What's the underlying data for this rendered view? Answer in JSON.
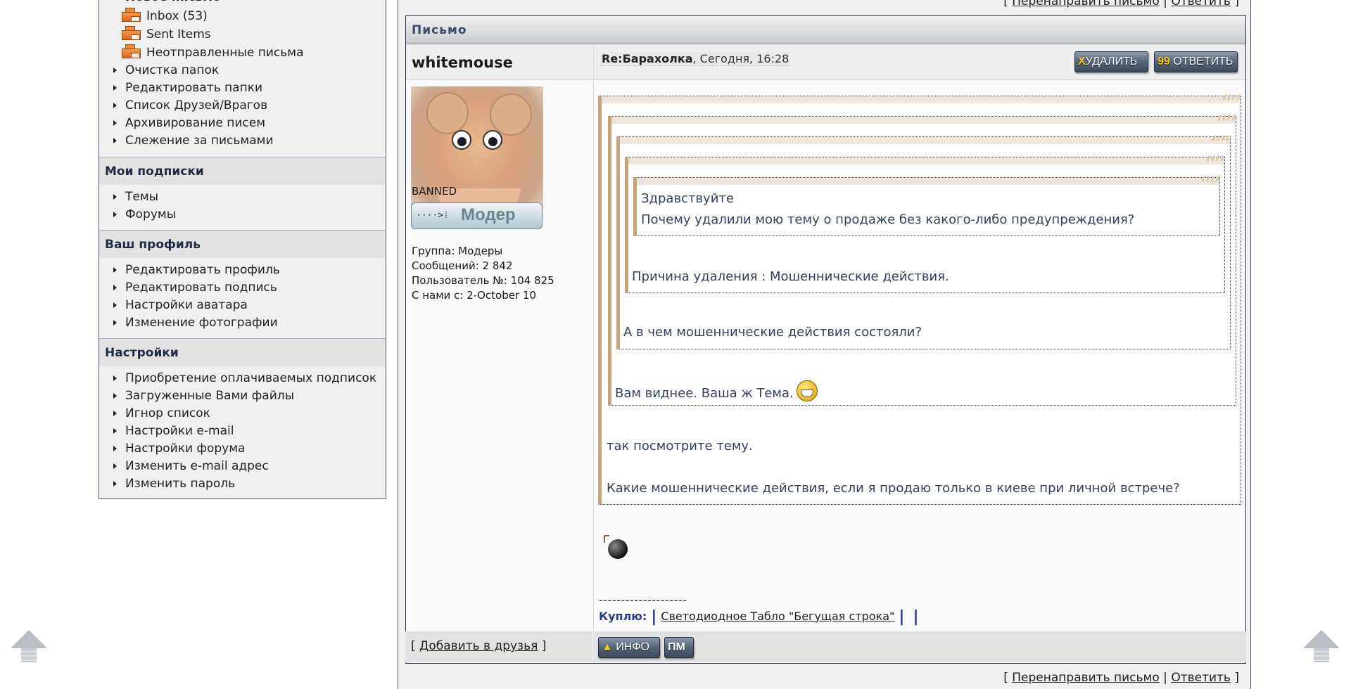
{
  "sidebar": {
    "new_message": "Новое письмо",
    "folders": [
      {
        "label": "Inbox (53)",
        "icon": "folder-icon"
      },
      {
        "label": "Sent Items",
        "icon": "folder-icon"
      },
      {
        "label": "Неотправленные письма",
        "icon": "folder-icon"
      }
    ],
    "pm_items": [
      "Очистка папок",
      "Редактировать папки",
      "Список Друзей/Врагов",
      "Архивирование писем",
      "Слежение за письмами"
    ],
    "sections": [
      {
        "title": "Мои подписки",
        "items": [
          "Темы",
          "Форумы"
        ]
      },
      {
        "title": "Ваш профиль",
        "items": [
          "Редактировать профиль",
          "Редактировать подпись",
          "Настройки аватара",
          "Изменение фотографии"
        ]
      },
      {
        "title": "Настройки",
        "items": [
          "Приобретение оплачиваемых подписок",
          "Загруженные Вами файлы",
          "Игнор список",
          "Настройки e-mail",
          "Настройки форума",
          "Изменить e-mail адрес",
          "Изменить пароль"
        ]
      }
    ]
  },
  "top_links": {
    "open": "[",
    "forward": "Перенаправить письмо",
    "sep": "|",
    "reply": "Ответить",
    "close": "]"
  },
  "panel": {
    "title": "Письмо"
  },
  "author": {
    "username": "whitemouse",
    "status": "BANNED",
    "rank_label": "Модер",
    "rank_arrow": "····>⁞",
    "group": "Группа: Модеры",
    "posts": "Сообщений: 2 842",
    "user_no": "Пользователь №: 104 825",
    "joined": "С нами с: 2-October 10",
    "add_friend_open": "[",
    "add_friend": "Добавить в друзья",
    "add_friend_close": "]"
  },
  "message": {
    "subject": "Re:Барахолка",
    "date": ", Сегодня, 16:28",
    "buttons": {
      "delete_glyph": "X",
      "delete": "УДАЛИТЬ",
      "reply_glyph": "99",
      "reply": "ОТВЕТИТЬ"
    },
    "quote_mark": "“”",
    "quotes": {
      "q5_line1": "Здравствуйте",
      "q5_line2": "Почему удалили мою тему о продаже без какого-либо предупреждения?",
      "q4": "Причина удаления : Мошеннические действия.",
      "q3": "А в чем мошеннические действия состояли?",
      "q2": "Вам виднее. Ваша ж Тема."
    },
    "body_line1": "так посмотрите тему.",
    "body_line2": "Какие мошеннические действия, если я продаю только в киеве при личной встрече?",
    "signature": {
      "dashes": "--------------------",
      "label": "Куплю:",
      "bar": "|",
      "link": "Светодиодное Табло \"Бегущая строка\""
    },
    "footer_buttons": {
      "info": "ИНФО",
      "pm": "ПМ"
    }
  }
}
